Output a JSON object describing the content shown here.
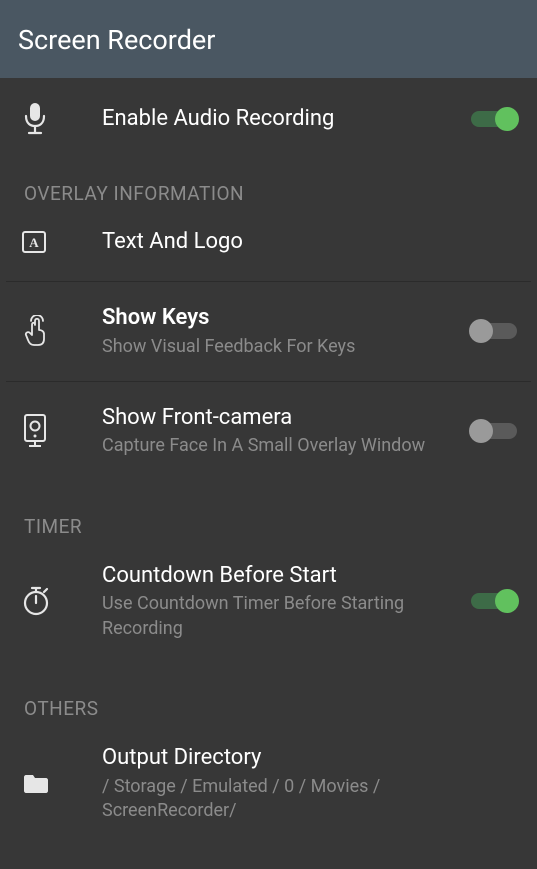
{
  "header": {
    "title": "Screen Recorder"
  },
  "audio": {
    "label": "Enable Audio Recording",
    "on": true
  },
  "section_overlay": "OVERLAY INFORMATION",
  "textlogo": {
    "label": "Text And Logo"
  },
  "showkeys": {
    "label": "Show Keys",
    "sub": "Show Visual Feedback For Keys",
    "on": false
  },
  "frontcam": {
    "label": "Show Front-camera",
    "sub": "Capture Face In A Small Overlay Window",
    "on": false
  },
  "section_timer": "TIMER",
  "countdown": {
    "label": "Countdown Before Start",
    "sub": "Use Countdown Timer Before Starting Recording",
    "on": true
  },
  "section_others": "OTHERS",
  "outdir": {
    "label": "Output Directory",
    "sub": "/ Storage / Emulated / 0 / Movies / ScreenRecorder/"
  }
}
